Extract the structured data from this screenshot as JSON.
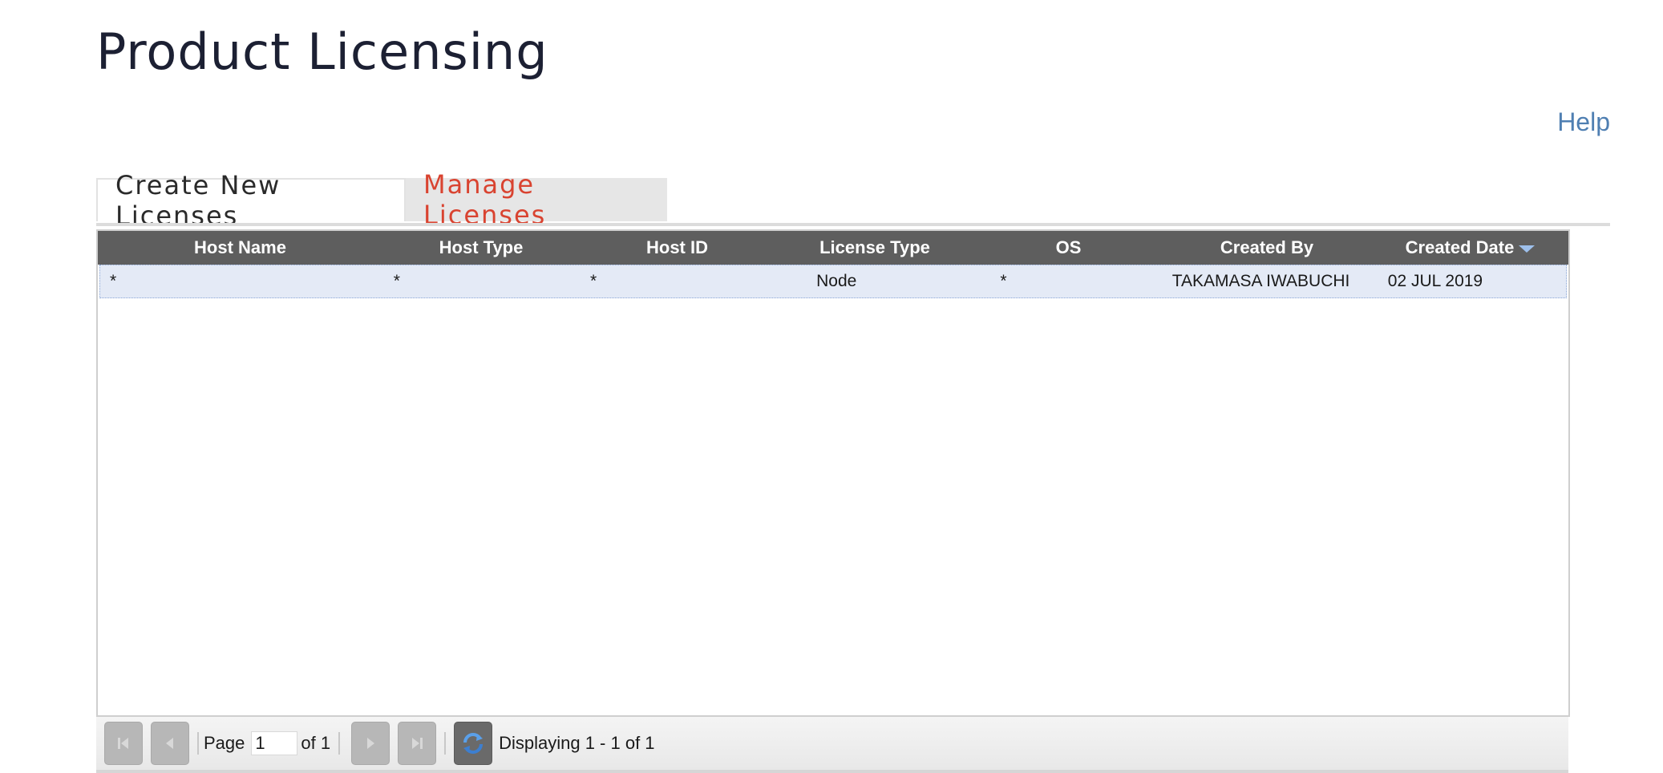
{
  "page": {
    "title": "Product Licensing",
    "help_label": "Help"
  },
  "tabs": [
    {
      "label": "Create New Licenses",
      "active": false
    },
    {
      "label": "Manage Licenses",
      "active": true
    }
  ],
  "grid": {
    "columns": [
      "Host Name",
      "Host Type",
      "Host ID",
      "License Type",
      "OS",
      "Created By",
      "Created Date"
    ],
    "sort": {
      "column": "Created Date",
      "direction": "descending"
    },
    "rows": [
      [
        "*",
        "*",
        "*",
        "Node",
        "*",
        "TAKAMASA IWABUCHI",
        "02 JUL 2019"
      ]
    ]
  },
  "pager": {
    "page_label": "Page",
    "page_value": "1",
    "of_label": "of 1",
    "display_text": "Displaying 1 - 1 of 1"
  },
  "colors": {
    "title": "#1c2033",
    "help_link": "#4f7fb2",
    "active_tab_text": "#d94330",
    "header_bg": "#5e5e5e",
    "selected_row_bg": "#e4eaf6"
  },
  "icons": [
    "first-page-icon",
    "prev-page-icon",
    "next-page-icon",
    "last-page-icon",
    "refresh-icon",
    "sort-desc-icon"
  ]
}
